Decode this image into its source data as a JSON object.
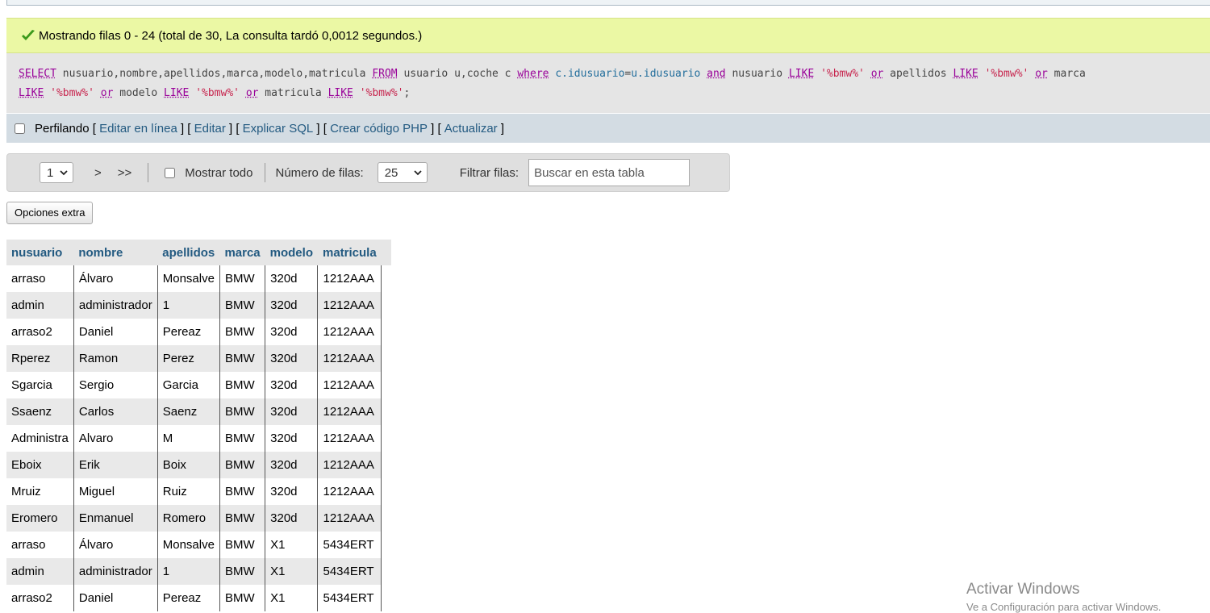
{
  "message": {
    "text": "Mostrando filas 0 - 24 (total de 30, La consulta tardó 0,0012 segundos.)",
    "color": "#ebf8a4"
  },
  "sql": {
    "line1": [
      {
        "t": "kw",
        "v": "SELECT"
      },
      {
        "t": "op",
        "v": " nusuario,nombre,apellidos,marca,modelo,matricula "
      },
      {
        "t": "kw",
        "v": "FROM"
      },
      {
        "t": "op",
        "v": " usuario u,coche c "
      },
      {
        "t": "kw",
        "v": "where"
      },
      {
        "t": "op",
        "v": " "
      },
      {
        "t": "tbl",
        "v": "c.idusuario"
      },
      {
        "t": "op",
        "v": "="
      },
      {
        "t": "tbl",
        "v": "u.idusuario"
      },
      {
        "t": "op",
        "v": " "
      },
      {
        "t": "kw",
        "v": "and"
      },
      {
        "t": "op",
        "v": " nusuario "
      },
      {
        "t": "kw",
        "v": "LIKE"
      },
      {
        "t": "op",
        "v": " "
      },
      {
        "t": "str",
        "v": "'%bmw%'"
      },
      {
        "t": "op",
        "v": " "
      },
      {
        "t": "kw",
        "v": "or"
      },
      {
        "t": "op",
        "v": " apellidos "
      },
      {
        "t": "kw",
        "v": "LIKE"
      },
      {
        "t": "op",
        "v": " "
      },
      {
        "t": "str",
        "v": "'%bmw%'"
      },
      {
        "t": "op",
        "v": " "
      },
      {
        "t": "kw",
        "v": "or"
      },
      {
        "t": "op",
        "v": " marca"
      }
    ],
    "line2": [
      {
        "t": "kw",
        "v": "LIKE"
      },
      {
        "t": "op",
        "v": " "
      },
      {
        "t": "str",
        "v": "'%bmw%'"
      },
      {
        "t": "op",
        "v": " "
      },
      {
        "t": "kw",
        "v": "or"
      },
      {
        "t": "op",
        "v": " modelo "
      },
      {
        "t": "kw",
        "v": "LIKE"
      },
      {
        "t": "op",
        "v": " "
      },
      {
        "t": "str",
        "v": "'%bmw%'"
      },
      {
        "t": "op",
        "v": " "
      },
      {
        "t": "kw",
        "v": "or"
      },
      {
        "t": "op",
        "v": " matricula "
      },
      {
        "t": "kw",
        "v": "LIKE"
      },
      {
        "t": "op",
        "v": " "
      },
      {
        "t": "str",
        "v": "'%bmw%'"
      },
      {
        "t": "op",
        "v": ";"
      }
    ]
  },
  "profile": {
    "label": "Perfilando",
    "links": [
      "Editar en línea",
      "Editar",
      "Explicar SQL",
      "Crear código PHP",
      "Actualizar"
    ]
  },
  "nav": {
    "page": "1",
    "next": ">",
    "last": ">>",
    "show_all": "Mostrar todo",
    "rows_label": "Número de filas:",
    "rows_value": "25",
    "filter_label": "Filtrar filas:",
    "filter_placeholder": "Buscar en esta tabla"
  },
  "extra_button": "Opciones extra",
  "table": {
    "columns": [
      "nusuario",
      "nombre",
      "apellidos",
      "marca",
      "modelo",
      "matricula"
    ],
    "rows": [
      [
        "arraso",
        "Álvaro",
        "Monsalve",
        "BMW",
        "320d",
        "1212AAA"
      ],
      [
        "admin",
        "administrador",
        "1",
        "BMW",
        "320d",
        "1212AAA"
      ],
      [
        "arraso2",
        "Daniel",
        "Pereaz",
        "BMW",
        "320d",
        "1212AAA"
      ],
      [
        "Rperez",
        "Ramon",
        "Perez",
        "BMW",
        "320d",
        "1212AAA"
      ],
      [
        "Sgarcia",
        "Sergio",
        "Garcia",
        "BMW",
        "320d",
        "1212AAA"
      ],
      [
        "Ssaenz",
        "Carlos",
        "Saenz",
        "BMW",
        "320d",
        "1212AAA"
      ],
      [
        "Administra",
        "Alvaro",
        "M",
        "BMW",
        "320d",
        "1212AAA"
      ],
      [
        "Eboix",
        "Erik",
        "Boix",
        "BMW",
        "320d",
        "1212AAA"
      ],
      [
        "Mruiz",
        "Miguel",
        "Ruiz",
        "BMW",
        "320d",
        "1212AAA"
      ],
      [
        "Eromero",
        "Enmanuel",
        "Romero",
        "BMW",
        "320d",
        "1212AAA"
      ],
      [
        "arraso",
        "Álvaro",
        "Monsalve",
        "BMW",
        "X1",
        "5434ERT"
      ],
      [
        "admin",
        "administrador",
        "1",
        "BMW",
        "X1",
        "5434ERT"
      ],
      [
        "arraso2",
        "Daniel",
        "Pereaz",
        "BMW",
        "X1",
        "5434ERT"
      ]
    ]
  },
  "watermark": {
    "title": "Activar Windows",
    "subtitle": "Ve a Configuración para activar Windows."
  }
}
